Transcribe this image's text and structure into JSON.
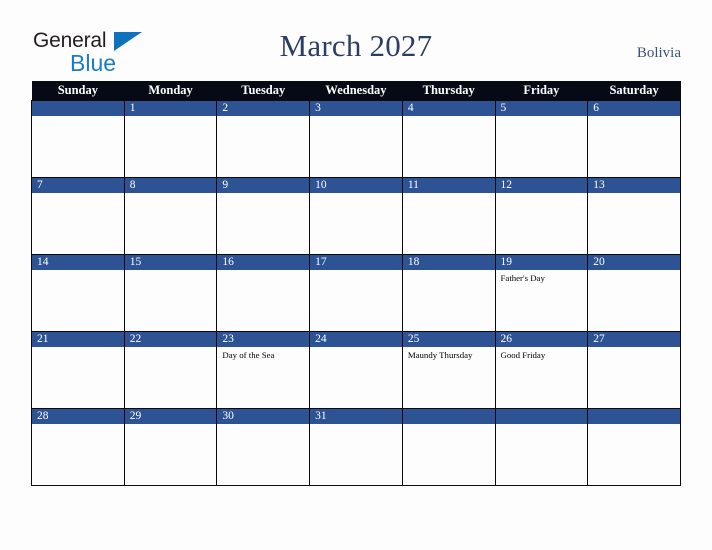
{
  "brand": {
    "name_part1": "General",
    "name_part2": "Blue",
    "triangle_color": "#0f72bd",
    "blue_color": "#1b7cc4"
  },
  "header": {
    "title": "March 2027",
    "country": "Bolivia",
    "title_color": "#2c3f63"
  },
  "colors": {
    "weekday_header_bg": "#050a14",
    "daynum_band_bg": "#2d5394",
    "cell_bg": "#fdfdfd",
    "grid_line": "#0a0a0a",
    "page_bg": "#fdfdfd"
  },
  "weekdays": [
    "Sunday",
    "Monday",
    "Tuesday",
    "Wednesday",
    "Thursday",
    "Friday",
    "Saturday"
  ],
  "weeks": [
    [
      {
        "day": "",
        "events": []
      },
      {
        "day": "1",
        "events": []
      },
      {
        "day": "2",
        "events": []
      },
      {
        "day": "3",
        "events": []
      },
      {
        "day": "4",
        "events": []
      },
      {
        "day": "5",
        "events": []
      },
      {
        "day": "6",
        "events": []
      }
    ],
    [
      {
        "day": "7",
        "events": []
      },
      {
        "day": "8",
        "events": []
      },
      {
        "day": "9",
        "events": []
      },
      {
        "day": "10",
        "events": []
      },
      {
        "day": "11",
        "events": []
      },
      {
        "day": "12",
        "events": []
      },
      {
        "day": "13",
        "events": []
      }
    ],
    [
      {
        "day": "14",
        "events": []
      },
      {
        "day": "15",
        "events": []
      },
      {
        "day": "16",
        "events": []
      },
      {
        "day": "17",
        "events": []
      },
      {
        "day": "18",
        "events": []
      },
      {
        "day": "19",
        "events": [
          "Father's Day"
        ]
      },
      {
        "day": "20",
        "events": []
      }
    ],
    [
      {
        "day": "21",
        "events": []
      },
      {
        "day": "22",
        "events": []
      },
      {
        "day": "23",
        "events": [
          "Day of the Sea"
        ]
      },
      {
        "day": "24",
        "events": []
      },
      {
        "day": "25",
        "events": [
          "Maundy Thursday"
        ]
      },
      {
        "day": "26",
        "events": [
          "Good Friday"
        ]
      },
      {
        "day": "27",
        "events": []
      }
    ],
    [
      {
        "day": "28",
        "events": []
      },
      {
        "day": "29",
        "events": []
      },
      {
        "day": "30",
        "events": []
      },
      {
        "day": "31",
        "events": []
      },
      {
        "day": "",
        "events": []
      },
      {
        "day": "",
        "events": []
      },
      {
        "day": "",
        "events": []
      }
    ]
  ]
}
